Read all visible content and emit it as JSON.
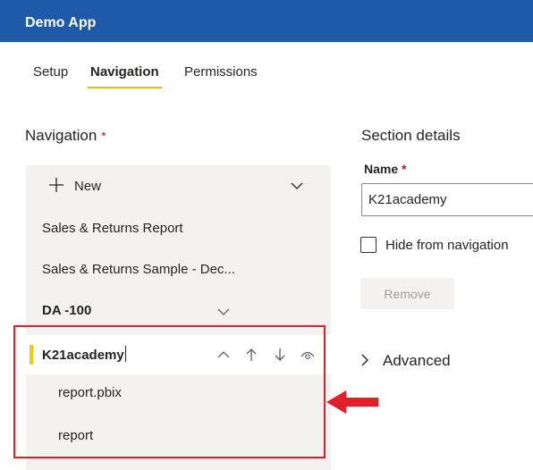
{
  "app": {
    "title": "Demo App",
    "brand_color": "#1e5aa8"
  },
  "tabs": [
    {
      "label": "Setup",
      "active": false
    },
    {
      "label": "Navigation",
      "active": true
    },
    {
      "label": "Permissions",
      "active": false
    }
  ],
  "navigation": {
    "heading": "Navigation",
    "required_mark": "*",
    "new_label": "New",
    "items": [
      {
        "label": "Sales & Returns Report"
      },
      {
        "label": "Sales & Returns Sample - Dec..."
      },
      {
        "label": "DA -100",
        "type": "section"
      }
    ],
    "selected_section": {
      "label": "K21academy",
      "accent_color": "#f2c811",
      "children": [
        {
          "label": "report.pbix"
        },
        {
          "label": "report"
        }
      ]
    },
    "highlight_color": "#e0202b"
  },
  "section_details": {
    "heading": "Section details",
    "name_label": "Name",
    "required_mark": "*",
    "name_value": "K21academy",
    "hide_label": "Hide from navigation",
    "hide_checked": false,
    "remove_label": "Remove",
    "advanced_label": "Advanced"
  }
}
